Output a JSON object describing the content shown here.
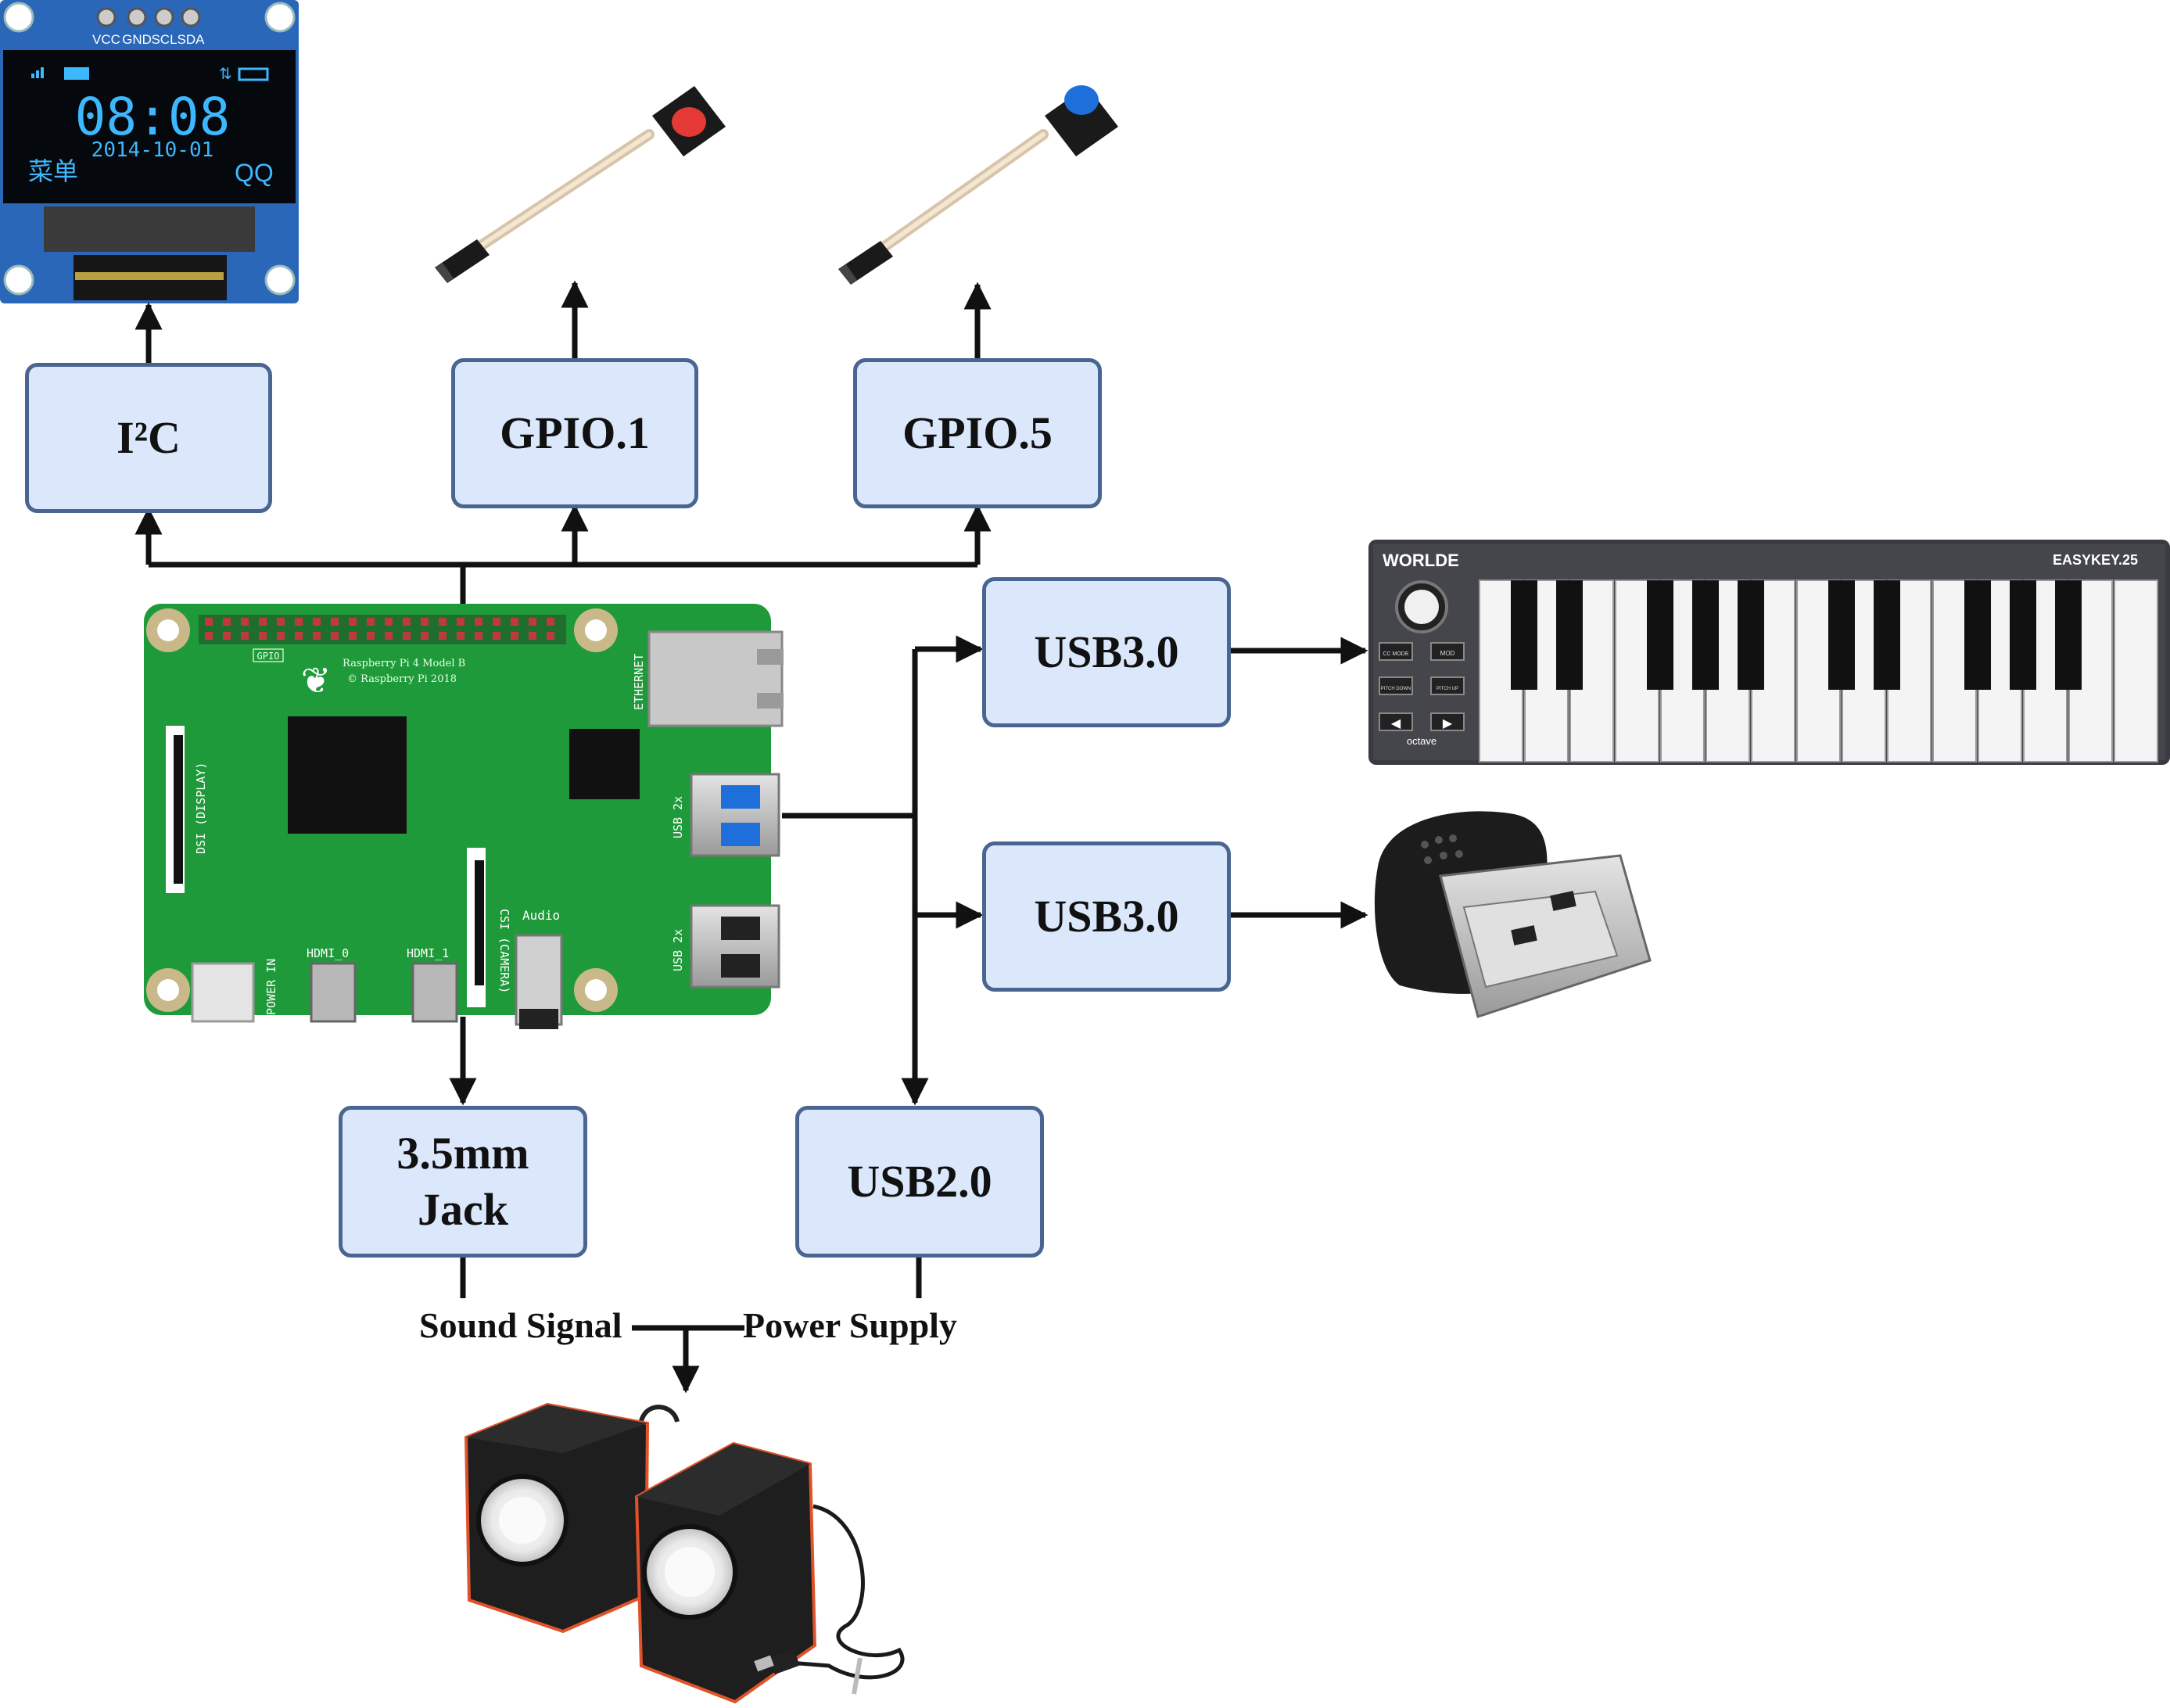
{
  "boxes": {
    "i2c": {
      "label": "I²C"
    },
    "gpio1": {
      "label": "GPIO.1"
    },
    "gpio5": {
      "label": "GPIO.5"
    },
    "usb3_keyboard": {
      "label": "USB3.0"
    },
    "usb3_mic": {
      "label": "USB3.0"
    },
    "jack": {
      "line1": "3.5mm",
      "line2": "Jack"
    },
    "usb2": {
      "label": "USB2.0"
    }
  },
  "labels": {
    "sound_signal": "Sound Signal",
    "power_supply": "Power Supply"
  },
  "oled": {
    "pins": [
      "VCC",
      "GND",
      "SCL",
      "SDA"
    ],
    "time": "08:08",
    "date": "2014-10-01",
    "menu": "菜单",
    "qq": "QQ"
  },
  "pi": {
    "model_line1": "Raspberry Pi 4 Model B",
    "model_line2": "© Raspberry Pi 2018",
    "gpio_tag": "GPIO",
    "ethernet": "ETHERNET",
    "dsi": "DSI (DISPLAY)",
    "csi": "CSI (CAMERA)",
    "audio": "Audio",
    "usb_top": "USB 2x",
    "usb_bottom": "USB 2x",
    "power_in": "POWER IN",
    "hdmi0": "HDMI_0",
    "hdmi1": "HDMI_1"
  },
  "keyboard": {
    "brand": "WORLDE",
    "model": "EASYKEY.25",
    "octave": "octave",
    "btn_cc": "CC MODE",
    "btn_mod": "MOD",
    "btn_pitch_down": "PITCH DOWN",
    "btn_pitch_up": "PITCH UP"
  },
  "colors": {
    "box_fill": "#dbe8fb",
    "box_border": "#4a6591",
    "pcb_green": "#1f9a3a",
    "button_red": "#e53935",
    "button_blue": "#1e6fd9",
    "oled_text": "#3db8ff"
  }
}
